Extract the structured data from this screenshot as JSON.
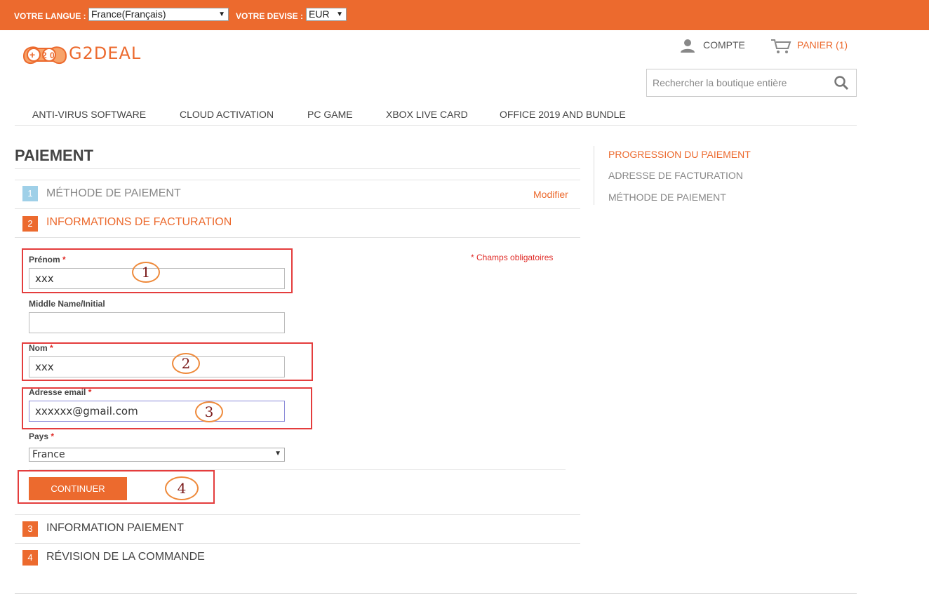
{
  "topbar": {
    "language_label": "VOTRE LANGUE :",
    "language_value": "France(Français)",
    "currency_label": "VOTRE DEVISE :",
    "currency_value": "EUR"
  },
  "logo": {
    "text": "G2DEAL"
  },
  "header": {
    "account_label": "COMPTE",
    "cart_label": "PANIER (1)",
    "search_placeholder": "Rechercher la boutique entière"
  },
  "nav": [
    "ANTI-VIRUS SOFTWARE",
    "CLOUD ACTIVATION",
    "PC GAME",
    "XBOX LIVE CARD",
    "OFFICE 2019 AND BUNDLE"
  ],
  "checkout": {
    "title": "PAIEMENT",
    "steps": [
      {
        "num": "1",
        "title": "MÉTHODE DE PAIEMENT",
        "action": "Modifier"
      },
      {
        "num": "2",
        "title": "INFORMATIONS DE FACTURATION"
      },
      {
        "num": "3",
        "title": "INFORMATION PAIEMENT"
      },
      {
        "num": "4",
        "title": "RÉVISION DE LA COMMANDE"
      }
    ],
    "required_note": "* Champs obligatoires",
    "form": {
      "first_name_label": "Prénom",
      "first_name_value": "xxx",
      "middle_name_label": "Middle Name/Initial",
      "middle_name_value": "",
      "last_name_label": "Nom",
      "last_name_value": "xxx",
      "email_label": "Adresse email",
      "email_value": "xxxxxx@gmail.com",
      "country_label": "Pays",
      "country_value": "France",
      "required_mark": "*"
    },
    "continue_label": "CONTINUER"
  },
  "annotations": [
    "1",
    "2",
    "3",
    "4"
  ],
  "sidebar": {
    "title": "PROGRESSION DU PAIEMENT",
    "items": [
      "ADRESSE DE FACTURATION",
      "MÉTHODE DE PAIEMENT"
    ]
  },
  "colors": {
    "brand": "#ec6a2e",
    "step_done": "#9fd0e8",
    "annotation_box": "#e43d3d",
    "annotation_circle": "#ee8a3b"
  }
}
